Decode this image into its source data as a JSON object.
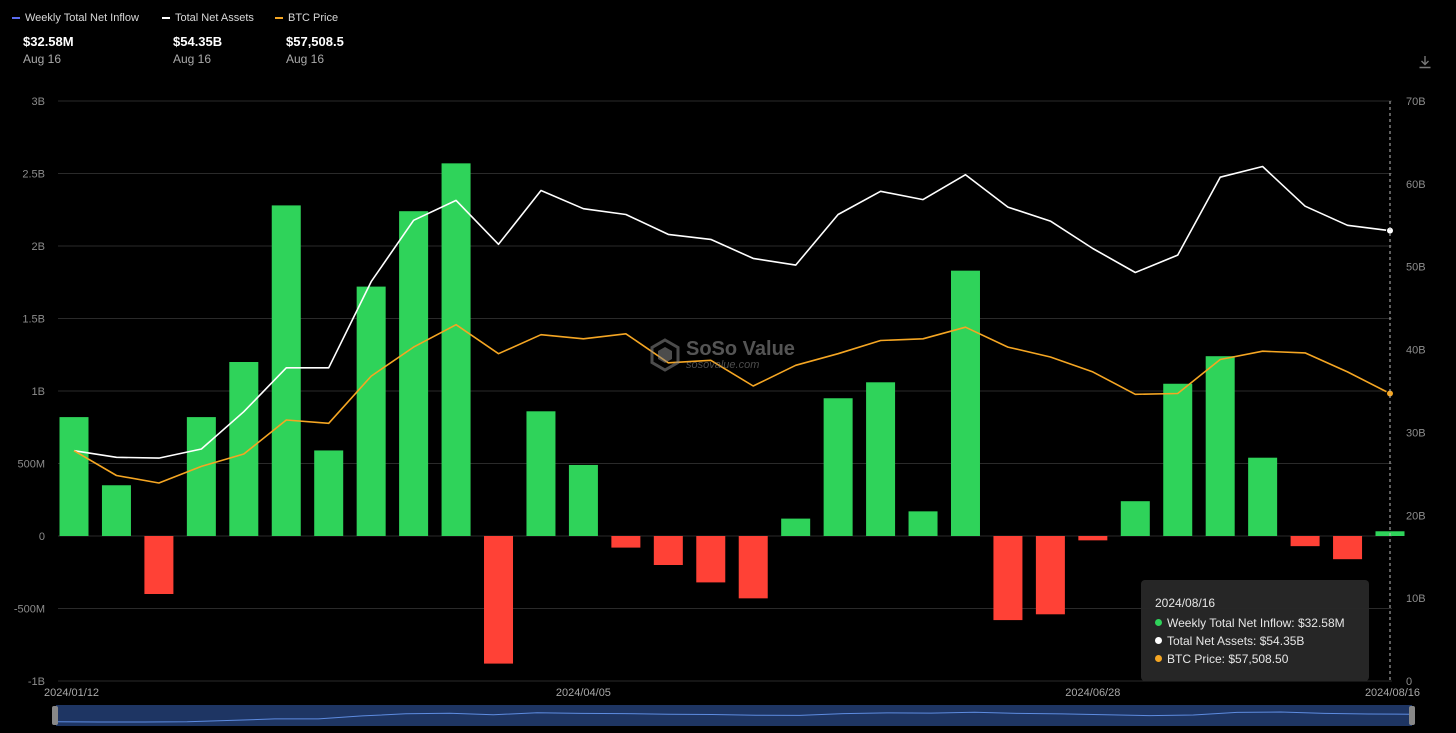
{
  "legend": [
    {
      "name": "Weekly Total Net Inflow",
      "value": "$32.58M",
      "date": "Aug 16",
      "color": "#5b6cf0"
    },
    {
      "name": "Total Net Assets",
      "value": "$54.35B",
      "date": "Aug 16",
      "color": "#ffffff"
    },
    {
      "name": "BTC Price",
      "value": "$57,508.5",
      "date": "Aug 16",
      "color": "#f5a623"
    }
  ],
  "tooltip": {
    "date": "2024/08/16",
    "rows": [
      {
        "text": "Weekly Total Net Inflow: $32.58M",
        "color": "#2fd35a"
      },
      {
        "text": "Total Net Assets: $54.35B",
        "color": "#ffffff"
      },
      {
        "text": "BTC Price: $57,508.50",
        "color": "#f5a623"
      }
    ]
  },
  "watermark": {
    "title": "SoSo Value",
    "subtitle": "sosovalue.com"
  },
  "icons": {
    "download": "download-icon",
    "logo": "sosovalue-logo-icon"
  },
  "chart_data": {
    "type": "bar",
    "x_tick_labels": [
      "2024/01/12",
      "2024/04/05",
      "2024/06/28",
      "2024/08/16"
    ],
    "y_left_ticks": [
      "3B",
      "2.5B",
      "2B",
      "1.5B",
      "1B",
      "500M",
      "0",
      "-500M",
      "-1B"
    ],
    "y_right_ticks": [
      "70B",
      "60B",
      "50B",
      "40B",
      "30B",
      "20B",
      "10B",
      "0"
    ],
    "ylim_left": [
      -1000,
      3000
    ],
    "ylim_right": [
      0,
      70
    ],
    "positive_color": "#2fd35a",
    "negative_color": "#ff4136",
    "series": [
      {
        "name": "Weekly Total Net Inflow",
        "axis": "left",
        "unit": "M",
        "values": [
          820,
          350,
          -400,
          820,
          1200,
          2280,
          590,
          1720,
          2240,
          2570,
          -880,
          860,
          490,
          -80,
          -200,
          -320,
          -430,
          120,
          950,
          1060,
          170,
          1830,
          -580,
          -540,
          -30,
          240,
          1050,
          1240,
          540,
          -70,
          -160,
          32.58
        ]
      },
      {
        "name": "Total Net Assets",
        "axis": "right",
        "unit": "B",
        "values": [
          27.8,
          27.0,
          26.9,
          28.0,
          32.5,
          37.8,
          37.8,
          48.2,
          55.6,
          58.0,
          52.7,
          59.2,
          57.0,
          56.3,
          53.9,
          53.3,
          51.0,
          50.2,
          56.3,
          59.1,
          58.1,
          61.1,
          57.2,
          55.5,
          52.2,
          49.3,
          51.4,
          60.8,
          62.1,
          57.3,
          55.0,
          54.35
        ]
      },
      {
        "name": "BTC Price",
        "axis": "right",
        "unit": "B-axis",
        "values": [
          27.8,
          24.8,
          23.9,
          25.9,
          27.4,
          31.5,
          31.1,
          36.8,
          40.3,
          43.0,
          39.5,
          41.8,
          41.3,
          41.9,
          38.4,
          38.7,
          35.6,
          38.1,
          39.5,
          41.1,
          41.3,
          42.7,
          40.3,
          39.1,
          37.3,
          34.6,
          34.7,
          38.8,
          39.8,
          39.6,
          37.3,
          34.7
        ]
      }
    ]
  }
}
